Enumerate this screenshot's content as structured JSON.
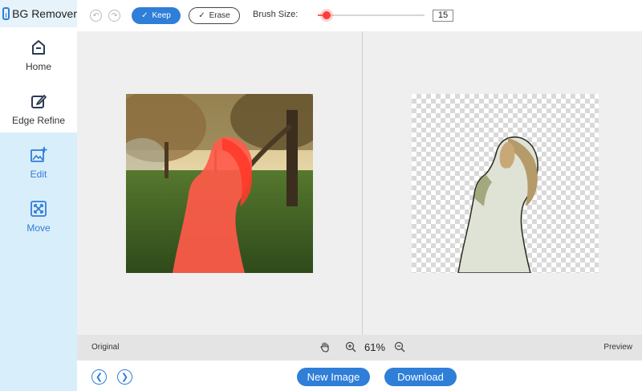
{
  "app": {
    "title": "BG Remover"
  },
  "sidebar": {
    "items": [
      {
        "label": "Home",
        "icon": "home-icon"
      },
      {
        "label": "Edge Refine",
        "icon": "edge-refine-icon"
      },
      {
        "label": "Edit",
        "icon": "edit-image-icon",
        "active": true
      },
      {
        "label": "Move",
        "icon": "move-icon"
      }
    ]
  },
  "toolbar": {
    "undo_icon": "undo-icon",
    "redo_icon": "redo-icon",
    "keep_label": "Keep",
    "erase_label": "Erase",
    "brush_size_label": "Brush Size:",
    "brush_size_value": "15",
    "brush_size_fraction": 0.08
  },
  "status": {
    "original_label": "Original",
    "preview_label": "Preview",
    "zoom": "61%"
  },
  "bottom": {
    "new_image_label": "New Image",
    "download_label": "Download"
  },
  "colors": {
    "accent": "#2f7ed8",
    "keep_overlay": "#ff5a4a",
    "slider": "#ff3b3b"
  }
}
